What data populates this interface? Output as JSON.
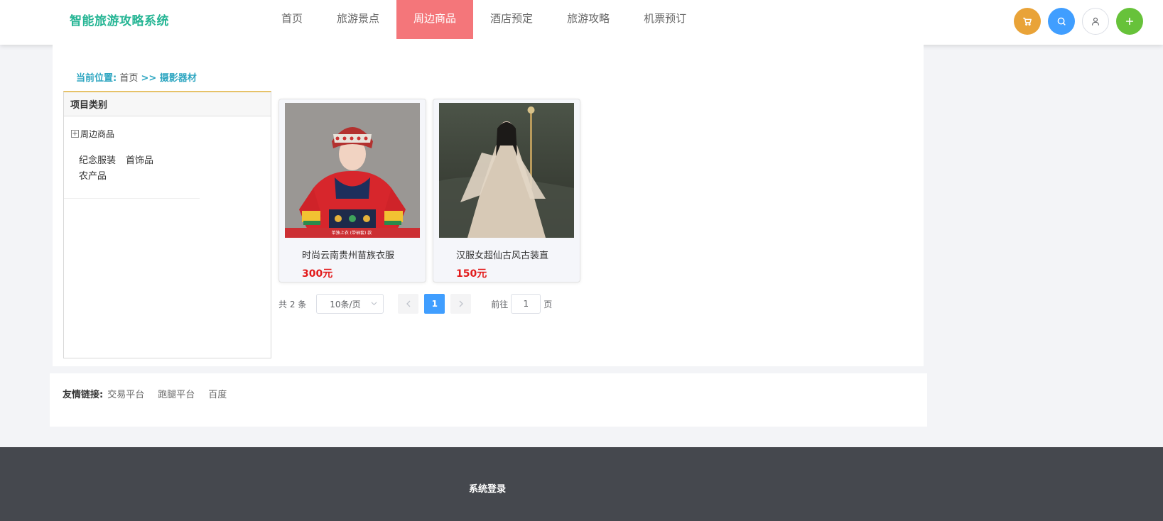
{
  "brand": {
    "title": "智能旅游攻略系统",
    "color": "#25b594"
  },
  "nav": {
    "items": [
      {
        "label": "首页"
      },
      {
        "label": "旅游景点"
      },
      {
        "label": "周边商品",
        "active": true
      },
      {
        "label": "酒店预定"
      },
      {
        "label": "旅游攻略"
      },
      {
        "label": "机票预订"
      }
    ],
    "active_color": "#f4767a"
  },
  "actions": [
    {
      "icon": "cart-icon",
      "color": "#e9a338"
    },
    {
      "icon": "search-icon",
      "color": "#409eff"
    },
    {
      "icon": "user-icon",
      "color": "#ffffff"
    },
    {
      "icon": "plus-icon",
      "color": "#67c23a"
    }
  ],
  "breadcrumb": {
    "label": "当前位置:",
    "home": "首页",
    "current": ">> 摄影器材"
  },
  "sidebar": {
    "title": "项目类别",
    "root": "周边商品",
    "children": [
      "纪念服装",
      "首饰品",
      "农产品"
    ]
  },
  "products": [
    {
      "name": "时尚云南贵州苗族衣服",
      "price": "300元",
      "image_caption": "单独上衣 (带袖套) 款"
    },
    {
      "name": "汉服女超仙古风古装直",
      "price": "150元"
    }
  ],
  "pagination": {
    "total_text": "共 2 条",
    "page_size": "10条/页",
    "current_page": "1",
    "goto_label": "前往",
    "goto_value": "1",
    "page_suffix": "页"
  },
  "friend_links": {
    "label": "友情链接:",
    "items": [
      "交易平台",
      "跑腿平台",
      "百度"
    ]
  },
  "footer": {
    "link": "系统登录"
  }
}
